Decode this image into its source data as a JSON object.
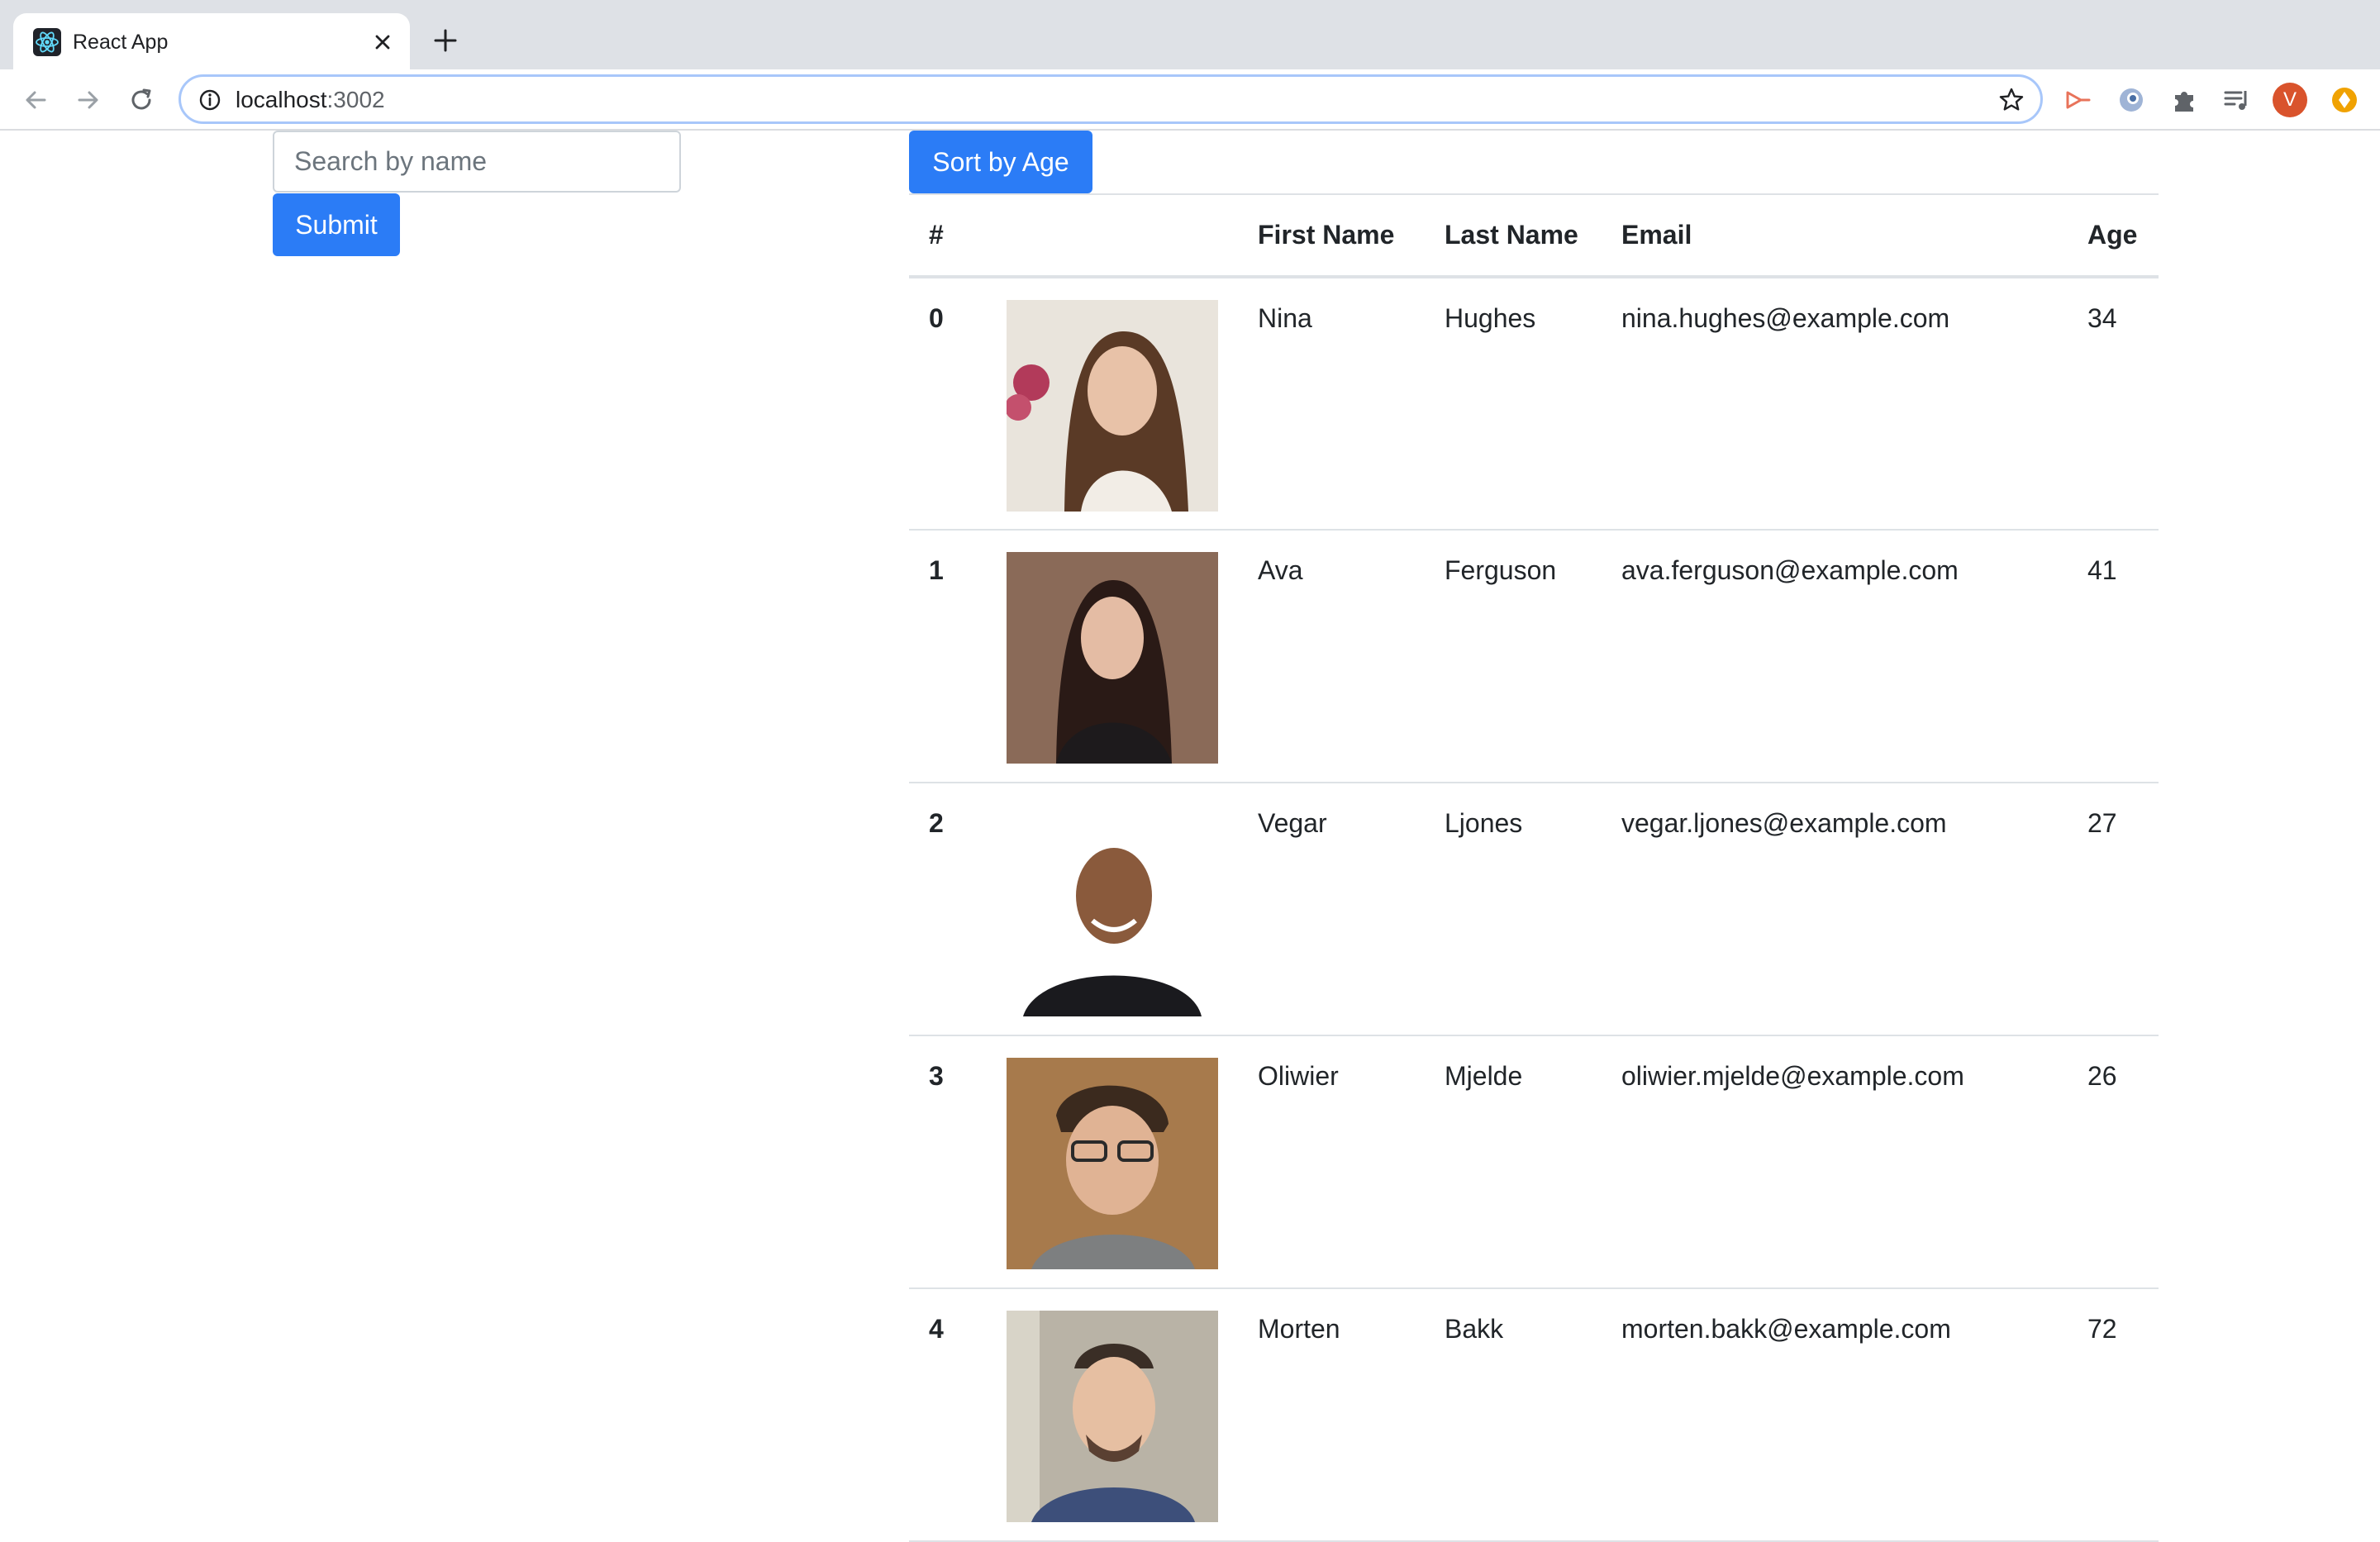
{
  "browser": {
    "tab_title": "React App",
    "url_host": "localhost",
    "url_port": ":3002",
    "profile_initial": "V"
  },
  "search": {
    "placeholder": "Search by name",
    "submit_label": "Submit"
  },
  "sort_button_label": "Sort by Age",
  "table": {
    "headers": [
      "#",
      "",
      "First Name",
      "Last Name",
      "Email",
      "Age"
    ],
    "rows": [
      {
        "index": "0",
        "first": "Nina",
        "last": "Hughes",
        "email": "nina.hughes@example.com",
        "age": "34"
      },
      {
        "index": "1",
        "first": "Ava",
        "last": "Ferguson",
        "email": "ava.ferguson@example.com",
        "age": "41"
      },
      {
        "index": "2",
        "first": "Vegar",
        "last": "Ljones",
        "email": "vegar.ljones@example.com",
        "age": "27"
      },
      {
        "index": "3",
        "first": "Oliwier",
        "last": "Mjelde",
        "email": "oliwier.mjelde@example.com",
        "age": "26"
      },
      {
        "index": "4",
        "first": "Morten",
        "last": "Bakk",
        "email": "morten.bakk@example.com",
        "age": "72"
      }
    ]
  },
  "colors": {
    "primary": "#2b7cf6",
    "border": "#dee2e6"
  }
}
